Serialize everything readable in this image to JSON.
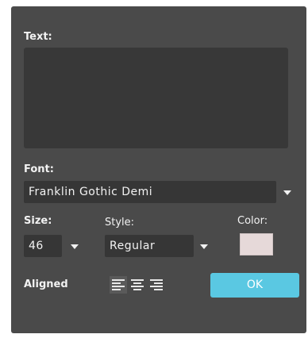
{
  "dialog": {
    "text_label": "Text:",
    "text_value": "",
    "font_label": "Font:",
    "font_value": "Franklin Gothic Demi",
    "size_label": "Size:",
    "size_value": "46",
    "style_label": "Style:",
    "style_value": "Regular",
    "color_label": "Color:",
    "color_value": "#e6d9d9",
    "aligned_label": "Aligned",
    "alignment_options": [
      "align-left-icon",
      "align-center-icon",
      "align-right-icon"
    ],
    "alignment_selected": "left",
    "ok_label": "OK"
  },
  "colors": {
    "panel": "#4a4a4a",
    "field": "#363636",
    "accent": "#5ac8e2"
  }
}
